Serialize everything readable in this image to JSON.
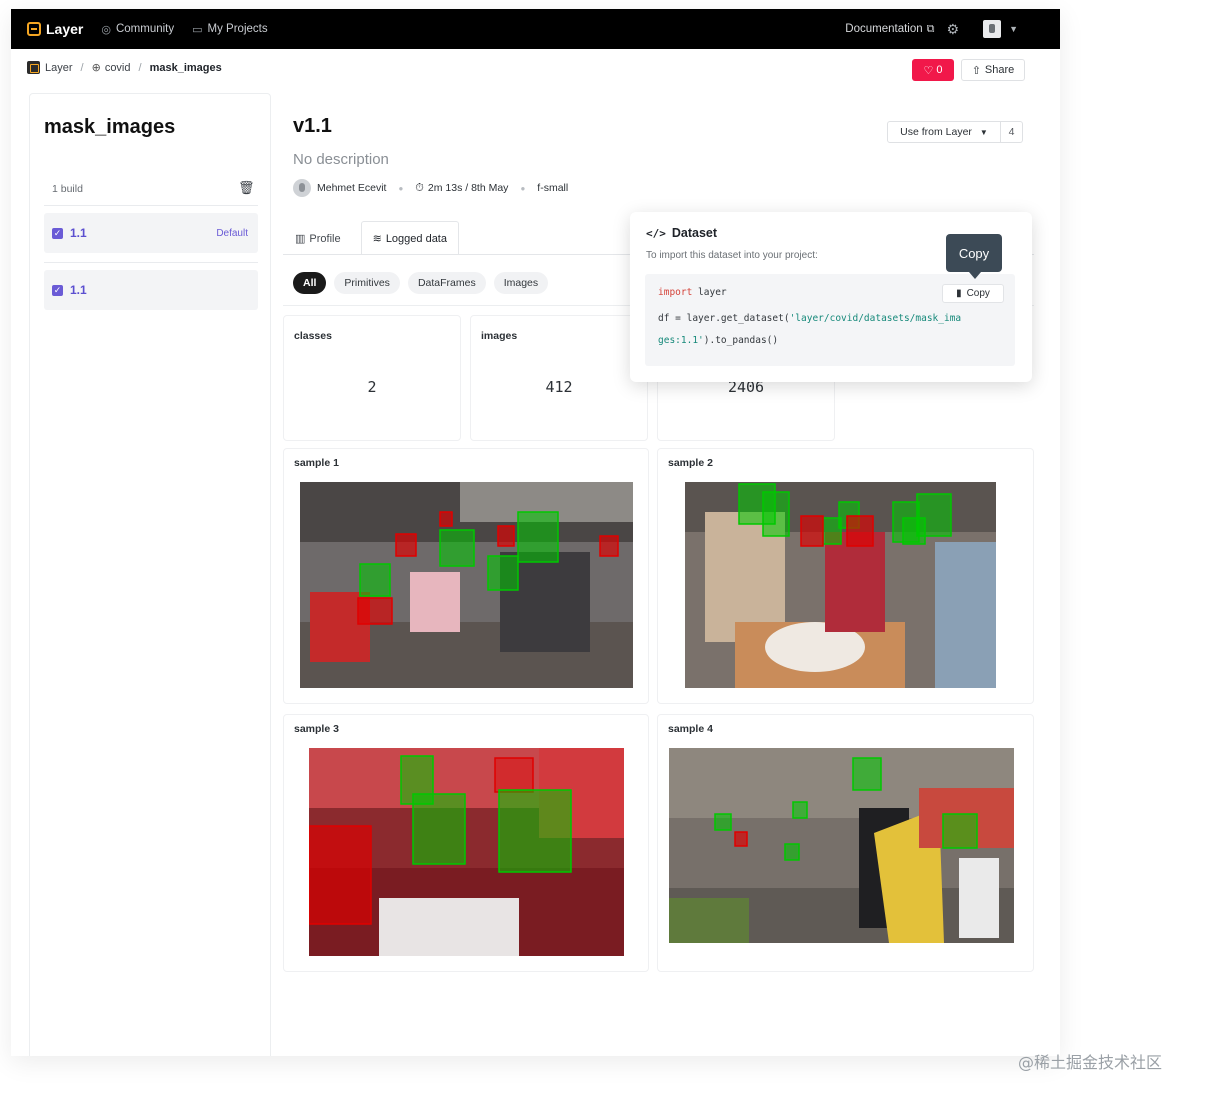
{
  "topnav": {
    "brand": "Layer",
    "links": [
      {
        "label": "Community",
        "icon": "compass-icon"
      },
      {
        "label": "My Projects",
        "icon": "folder-icon"
      }
    ],
    "documentation": "Documentation"
  },
  "breadcrumb": {
    "root": "Layer",
    "project": "covid",
    "current": "mask_images"
  },
  "actions": {
    "like_count": "0",
    "share_label": "Share"
  },
  "sidebar": {
    "title": "mask_images",
    "builds_label": "1 build",
    "items": [
      {
        "version": "1.1",
        "badge": "Default"
      },
      {
        "version": "1.1",
        "badge": ""
      }
    ]
  },
  "main": {
    "version": "v1.1",
    "description": "No description",
    "author": "Mehmet Ecevit",
    "duration": "2m 13s / 8th May",
    "fabric": "f-small",
    "use_button": "Use from Layer",
    "use_count": "4",
    "tabs": [
      {
        "label": "Profile"
      },
      {
        "label": "Logged data"
      }
    ],
    "filters": [
      "All",
      "Primitives",
      "DataFrames",
      "Images"
    ],
    "stats": [
      {
        "label": "classes",
        "value": "2"
      },
      {
        "label": "images",
        "value": "412"
      },
      {
        "label": "",
        "value": "2406"
      }
    ],
    "samples": [
      {
        "label": "sample 1"
      },
      {
        "label": "sample 2"
      },
      {
        "label": "sample 3"
      },
      {
        "label": "sample 4"
      }
    ]
  },
  "popover": {
    "title": "Dataset",
    "subtitle": "To import this dataset into your project:",
    "code_import_kw": "import",
    "code_import_mod": " layer",
    "code_line2_a": "df = layer.get_dataset(",
    "code_line2_str": "'layer/covid/datasets/mask_ima",
    "code_line3_str": "ges:1.1'",
    "code_line3_b": ").to_pandas()",
    "copy_label": "Copy"
  },
  "tooltip": "Copy",
  "watermark": "@稀土掘金技术社区",
  "colors": {
    "nav_bg": "#000000",
    "accent_purple": "#6a5bd6",
    "like_red": "#f1184a",
    "mask_box": "#00c800",
    "no_mask_box": "#e00000"
  }
}
